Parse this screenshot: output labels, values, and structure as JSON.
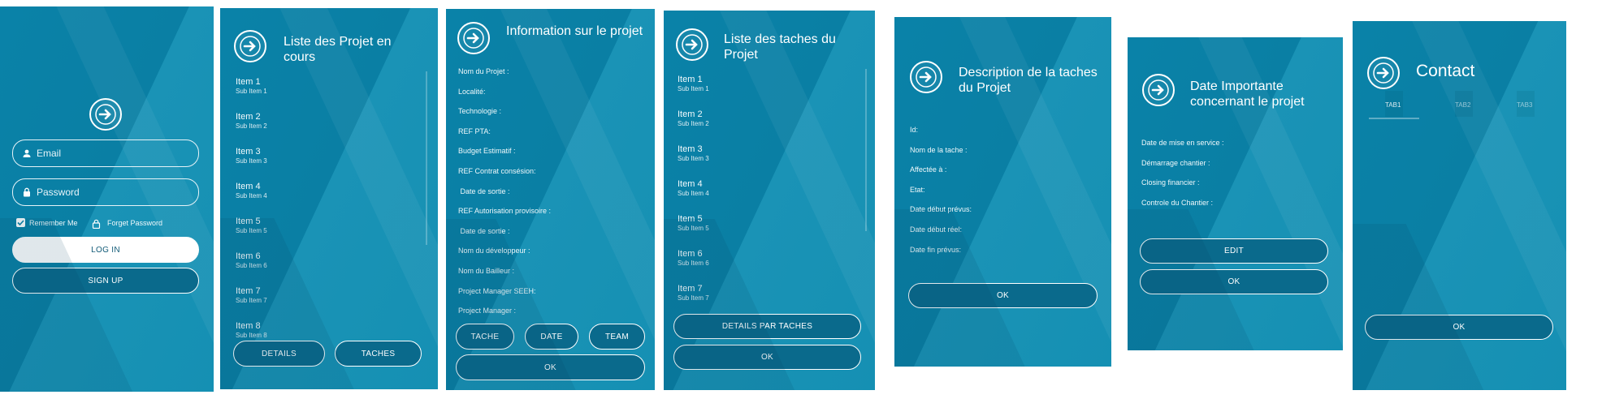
{
  "login": {
    "email_placeholder": "Email",
    "password_placeholder": "Password",
    "remember_label": "Remember Me",
    "forget_label": "Forget Password",
    "login_button": "LOG IN",
    "signup_button": "SIGN UP"
  },
  "projects": {
    "title": "Liste des Projet en cours",
    "items": [
      {
        "label": "Item 1",
        "sub": "Sub Item 1"
      },
      {
        "label": "Item 2",
        "sub": "Sub Item 2"
      },
      {
        "label": "Item 3",
        "sub": "Sub Item 3"
      },
      {
        "label": "Item 4",
        "sub": "Sub Item 4"
      },
      {
        "label": "Item 5",
        "sub": "Sub Item 5"
      },
      {
        "label": "Item 6",
        "sub": "Sub Item 6"
      },
      {
        "label": "Item 7",
        "sub": "Sub Item 7"
      },
      {
        "label": "Item 8",
        "sub": "Sub Item 8"
      }
    ],
    "details_button": "DETAILS",
    "taches_button": "TACHES"
  },
  "project_info": {
    "title": "Information sur le projet",
    "fields": [
      "Nom du Projet :",
      "Localité:",
      "Technologie :",
      "REF PTA:",
      "Budget Estimatif :",
      "REF Contrat consésion:",
      " Date de sortie :",
      "REF Autorisation provisoire :",
      " Date de sortie :",
      "Nom du développeur :",
      "Nom du Bailleur :",
      "Project Manager SEEH:",
      "Project Manager :"
    ],
    "tache_button": "TACHE",
    "date_button": "DATE",
    "team_button": "TEAM",
    "ok_button": "OK"
  },
  "tasks": {
    "title": "Liste des taches du Projet",
    "items": [
      {
        "label": "Item 1",
        "sub": "Sub Item 1"
      },
      {
        "label": "Item 2",
        "sub": "Sub Item 2"
      },
      {
        "label": "Item 3",
        "sub": "Sub Item 3"
      },
      {
        "label": "Item 4",
        "sub": "Sub Item 4"
      },
      {
        "label": "Item 5",
        "sub": "Sub Item 5"
      },
      {
        "label": "Item 6",
        "sub": "Sub Item 6"
      },
      {
        "label": "Item 7",
        "sub": "Sub Item 7"
      }
    ],
    "details_button": "DETAILS PAR TACHES",
    "ok_button": "OK"
  },
  "task_desc": {
    "title": "Description de la taches du Projet",
    "fields": [
      "Id:",
      "Nom de la tache :",
      "Affectée à :",
      "Etat:",
      "Date début prévus:",
      "Date début réel:",
      "Date fin prévus:"
    ],
    "ok_button": "OK"
  },
  "dates": {
    "title": "Date Importante concernant le projet",
    "fields": [
      "Date de mise en service :",
      "Démarrage chantier :",
      "Closing financier :",
      "Controle du Chantier :"
    ],
    "edit_button": "EDIT",
    "ok_button": "OK"
  },
  "contact": {
    "title": "Contact",
    "tabs": [
      "TAB1",
      "TAB2",
      "TAB3"
    ],
    "ok_button": "OK"
  },
  "icons": {
    "logo": "arrow-right-circle-icon",
    "user": "person-icon",
    "lock": "lock-icon",
    "checkbox": "checkbox-checked-icon"
  },
  "colors": {
    "panel": "#0a82a8",
    "button_dark": "#0a6a8c",
    "button_light": "#ffffff"
  }
}
